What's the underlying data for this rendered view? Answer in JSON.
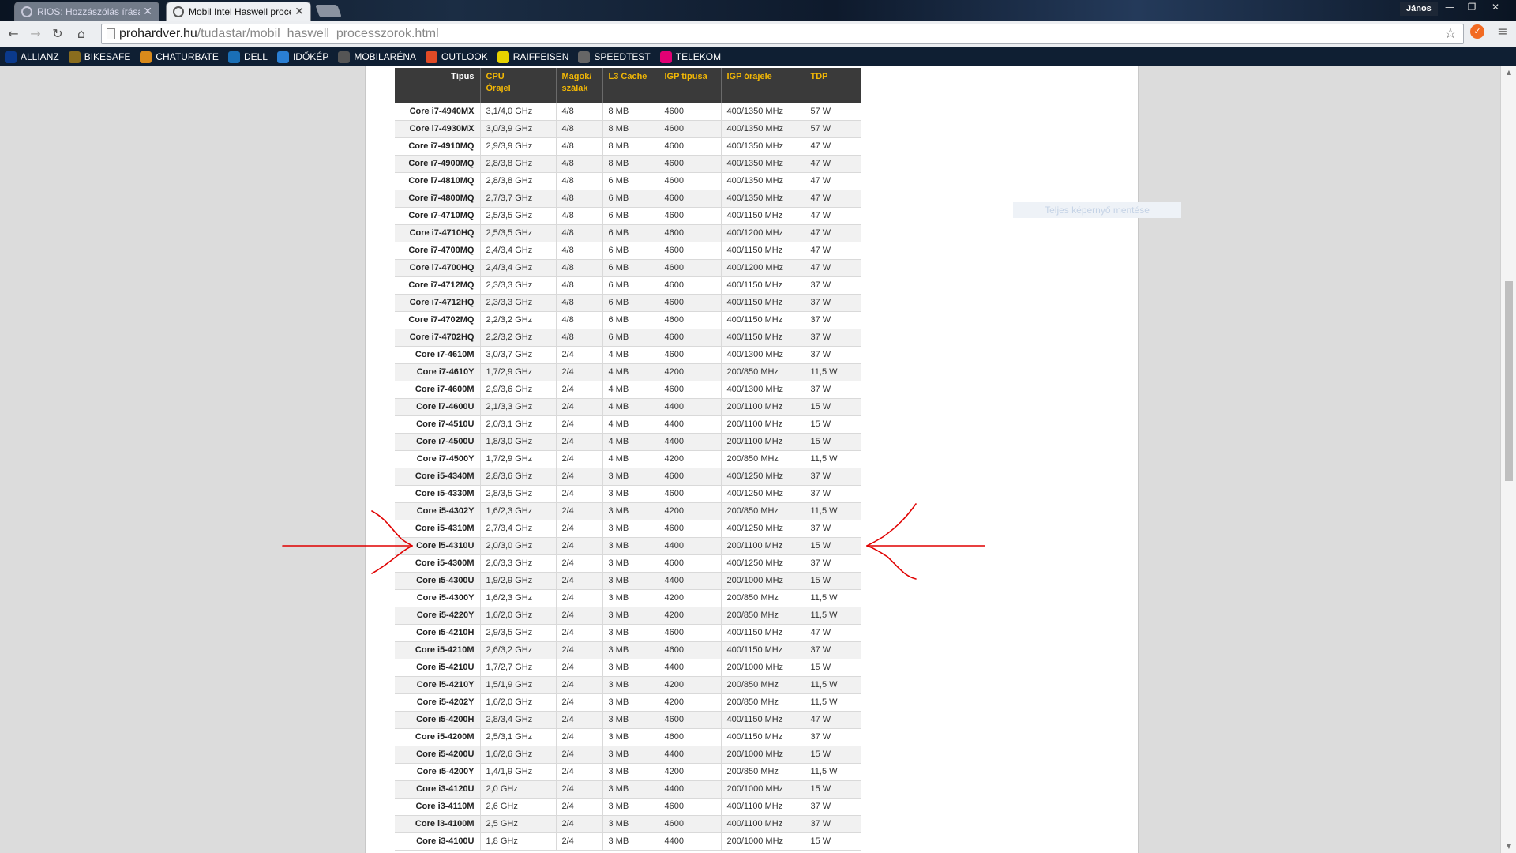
{
  "browser": {
    "tabs": [
      {
        "title": "RIOS: Hozzászólás írása - ",
        "active": false
      },
      {
        "title": "Mobil Intel Haswell proce",
        "active": true
      }
    ],
    "user_name": "János",
    "window_controls": {
      "minimize": "—",
      "restore": "❐",
      "close": "✕"
    },
    "url": {
      "host": "prohardver.hu",
      "path": "/tudastar/mobil_haswell_processzorok.html"
    },
    "bookmarks": [
      {
        "label": "ALLIANZ",
        "icon": "allianz-icon",
        "color": "#0b3a8c"
      },
      {
        "label": "BIKESAFE",
        "icon": "bikesafe-icon",
        "color": "#8a6d1e"
      },
      {
        "label": "CHATURBATE",
        "icon": "chaturbate-icon",
        "color": "#d98a1b"
      },
      {
        "label": "DELL",
        "icon": "dell-icon",
        "color": "#1a6fb6"
      },
      {
        "label": "IDŐKÉP",
        "icon": "idokep-icon",
        "color": "#2a7fd4"
      },
      {
        "label": "MOBILARÉNA",
        "icon": "mobilarena-icon",
        "color": "#555555"
      },
      {
        "label": "OUTLOOK",
        "icon": "outlook-icon",
        "color": "#e04a26"
      },
      {
        "label": "RAIFFEISEN",
        "icon": "raiffeisen-icon",
        "color": "#e6d200"
      },
      {
        "label": "SPEEDTEST",
        "icon": "speedtest-icon",
        "color": "#666666"
      },
      {
        "label": "TELEKOM",
        "icon": "telekom-icon",
        "color": "#e20074"
      }
    ]
  },
  "page": {
    "ghost_text": "Teljes képernyő mentése",
    "table": {
      "headers": {
        "type": "Típus",
        "cpu": [
          "CPU",
          "Órajel"
        ],
        "cores": [
          "Magok/",
          "szálak"
        ],
        "l3": "L3 Cache",
        "igp_type": "IGP típusa",
        "igp_clock": "IGP órajele",
        "tdp": "TDP"
      },
      "rows": [
        [
          "Core i7-4940MX",
          "3,1/4,0 GHz",
          "4/8",
          "8 MB",
          "4600",
          "400/1350 MHz",
          "57 W"
        ],
        [
          "Core i7-4930MX",
          "3,0/3,9 GHz",
          "4/8",
          "8 MB",
          "4600",
          "400/1350 MHz",
          "57 W"
        ],
        [
          "Core i7-4910MQ",
          "2,9/3,9 GHz",
          "4/8",
          "8 MB",
          "4600",
          "400/1350 MHz",
          "47 W"
        ],
        [
          "Core i7-4900MQ",
          "2,8/3,8 GHz",
          "4/8",
          "8 MB",
          "4600",
          "400/1350 MHz",
          "47 W"
        ],
        [
          "Core i7-4810MQ",
          "2,8/3,8 GHz",
          "4/8",
          "6 MB",
          "4600",
          "400/1350 MHz",
          "47 W"
        ],
        [
          "Core i7-4800MQ",
          "2,7/3,7 GHz",
          "4/8",
          "6 MB",
          "4600",
          "400/1350 MHz",
          "47 W"
        ],
        [
          "Core i7-4710MQ",
          "2,5/3,5 GHz",
          "4/8",
          "6 MB",
          "4600",
          "400/1150 MHz",
          "47 W"
        ],
        [
          "Core i7-4710HQ",
          "2,5/3,5 GHz",
          "4/8",
          "6 MB",
          "4600",
          "400/1200 MHz",
          "47 W"
        ],
        [
          "Core i7-4700MQ",
          "2,4/3,4 GHz",
          "4/8",
          "6 MB",
          "4600",
          "400/1150 MHz",
          "47 W"
        ],
        [
          "Core i7-4700HQ",
          "2,4/3,4 GHz",
          "4/8",
          "6 MB",
          "4600",
          "400/1200 MHz",
          "47 W"
        ],
        [
          "Core i7-4712MQ",
          "2,3/3,3 GHz",
          "4/8",
          "6 MB",
          "4600",
          "400/1150 MHz",
          "37 W"
        ],
        [
          "Core i7-4712HQ",
          "2,3/3,3 GHz",
          "4/8",
          "6 MB",
          "4600",
          "400/1150 MHz",
          "37 W"
        ],
        [
          "Core i7-4702MQ",
          "2,2/3,2 GHz",
          "4/8",
          "6 MB",
          "4600",
          "400/1150 MHz",
          "37 W"
        ],
        [
          "Core i7-4702HQ",
          "2,2/3,2 GHz",
          "4/8",
          "6 MB",
          "4600",
          "400/1150 MHz",
          "37 W"
        ],
        [
          "Core i7-4610M",
          "3,0/3,7 GHz",
          "2/4",
          "4 MB",
          "4600",
          "400/1300 MHz",
          "37 W"
        ],
        [
          "Core i7-4610Y",
          "1,7/2,9 GHz",
          "2/4",
          "4 MB",
          "4200",
          "200/850 MHz",
          "11,5 W"
        ],
        [
          "Core i7-4600M",
          "2,9/3,6 GHz",
          "2/4",
          "4 MB",
          "4600",
          "400/1300 MHz",
          "37 W"
        ],
        [
          "Core i7-4600U",
          "2,1/3,3 GHz",
          "2/4",
          "4 MB",
          "4400",
          "200/1100 MHz",
          "15 W"
        ],
        [
          "Core i7-4510U",
          "2,0/3,1 GHz",
          "2/4",
          "4 MB",
          "4400",
          "200/1100 MHz",
          "15 W"
        ],
        [
          "Core i7-4500U",
          "1,8/3,0 GHz",
          "2/4",
          "4 MB",
          "4400",
          "200/1100 MHz",
          "15 W"
        ],
        [
          "Core i7-4500Y",
          "1,7/2,9 GHz",
          "2/4",
          "4 MB",
          "4200",
          "200/850 MHz",
          "11,5 W"
        ],
        [
          "Core i5-4340M",
          "2,8/3,6 GHz",
          "2/4",
          "3 MB",
          "4600",
          "400/1250 MHz",
          "37 W"
        ],
        [
          "Core i5-4330M",
          "2,8/3,5 GHz",
          "2/4",
          "3 MB",
          "4600",
          "400/1250 MHz",
          "37 W"
        ],
        [
          "Core i5-4302Y",
          "1,6/2,3 GHz",
          "2/4",
          "3 MB",
          "4200",
          "200/850 MHz",
          "11,5 W"
        ],
        [
          "Core i5-4310M",
          "2,7/3,4 GHz",
          "2/4",
          "3 MB",
          "4600",
          "400/1250 MHz",
          "37 W"
        ],
        [
          "Core i5-4310U",
          "2,0/3,0 GHz",
          "2/4",
          "3 MB",
          "4400",
          "200/1100 MHz",
          "15 W"
        ],
        [
          "Core i5-4300M",
          "2,6/3,3 GHz",
          "2/4",
          "3 MB",
          "4600",
          "400/1250 MHz",
          "37 W"
        ],
        [
          "Core i5-4300U",
          "1,9/2,9 GHz",
          "2/4",
          "3 MB",
          "4400",
          "200/1000 MHz",
          "15 W"
        ],
        [
          "Core i5-4300Y",
          "1,6/2,3 GHz",
          "2/4",
          "3 MB",
          "4200",
          "200/850 MHz",
          "11,5 W"
        ],
        [
          "Core i5-4220Y",
          "1,6/2,0 GHz",
          "2/4",
          "3 MB",
          "4200",
          "200/850 MHz",
          "11,5 W"
        ],
        [
          "Core i5-4210H",
          "2,9/3,5 GHz",
          "2/4",
          "3 MB",
          "4600",
          "400/1150 MHz",
          "47 W"
        ],
        [
          "Core i5-4210M",
          "2,6/3,2 GHz",
          "2/4",
          "3 MB",
          "4600",
          "400/1150 MHz",
          "37 W"
        ],
        [
          "Core i5-4210U",
          "1,7/2,7 GHz",
          "2/4",
          "3 MB",
          "4400",
          "200/1000 MHz",
          "15 W"
        ],
        [
          "Core i5-4210Y",
          "1,5/1,9 GHz",
          "2/4",
          "3 MB",
          "4200",
          "200/850 MHz",
          "11,5 W"
        ],
        [
          "Core i5-4202Y",
          "1,6/2,0 GHz",
          "2/4",
          "3 MB",
          "4200",
          "200/850 MHz",
          "11,5 W"
        ],
        [
          "Core i5-4200H",
          "2,8/3,4 GHz",
          "2/4",
          "3 MB",
          "4600",
          "400/1150 MHz",
          "47 W"
        ],
        [
          "Core i5-4200M",
          "2,5/3,1 GHz",
          "2/4",
          "3 MB",
          "4600",
          "400/1150 MHz",
          "37 W"
        ],
        [
          "Core i5-4200U",
          "1,6/2,6 GHz",
          "2/4",
          "3 MB",
          "4400",
          "200/1000 MHz",
          "15 W"
        ],
        [
          "Core i5-4200Y",
          "1,4/1,9 GHz",
          "2/4",
          "3 MB",
          "4200",
          "200/850 MHz",
          "11,5 W"
        ],
        [
          "Core i3-4120U",
          "2,0 GHz",
          "2/4",
          "3 MB",
          "4400",
          "200/1000 MHz",
          "15 W"
        ],
        [
          "Core i3-4110M",
          "2,6 GHz",
          "2/4",
          "3 MB",
          "4600",
          "400/1100 MHz",
          "37 W"
        ],
        [
          "Core i3-4100M",
          "2,5 GHz",
          "2/4",
          "3 MB",
          "4600",
          "400/1100 MHz",
          "37 W"
        ],
        [
          "Core i3-4100U",
          "1,8 GHz",
          "2/4",
          "3 MB",
          "4400",
          "200/1000 MHz",
          "15 W"
        ]
      ]
    }
  },
  "colors": {
    "header_bg": "#3a3a3a",
    "header_text": "#f2b705",
    "annotation": "#e00000"
  }
}
